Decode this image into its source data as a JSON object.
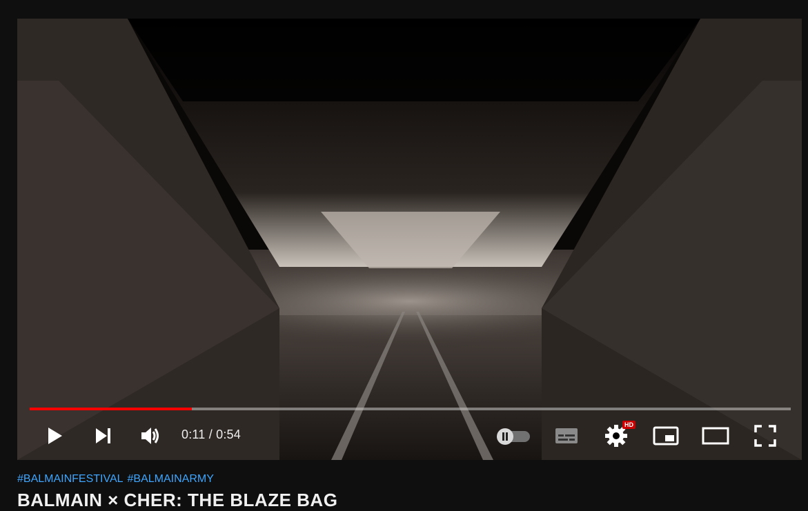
{
  "player": {
    "current_time": "0:11",
    "duration": "0:54",
    "time_separator": " / ",
    "progress_fraction": 0.213,
    "hd_badge": "HD",
    "colors": {
      "progress": "#ff0000",
      "badge": "#cc0000"
    },
    "icons": [
      "play-icon",
      "next-icon",
      "volume-icon",
      "autoplay-toggle-icon",
      "subtitles-icon",
      "settings-icon",
      "miniplayer-icon",
      "theater-mode-icon",
      "fullscreen-icon"
    ]
  },
  "video": {
    "hashtags": [
      "#BALMAINFESTIVAL",
      "#BALMAINARMY"
    ],
    "title": "BALMAIN × CHER: THE BLAZE BAG"
  }
}
